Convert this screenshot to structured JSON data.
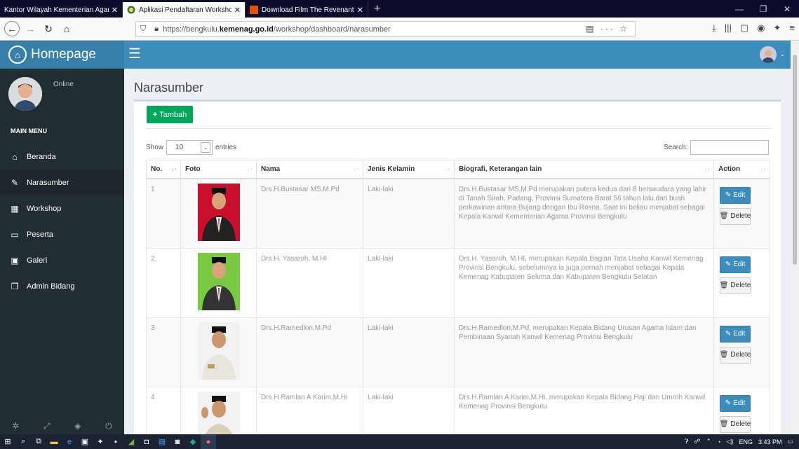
{
  "browser": {
    "tabs": [
      {
        "title": "Kantor Wilayah Kementerian Agam",
        "active": false
      },
      {
        "title": "Aplikasi Pendaftaran Workshop",
        "active": true
      },
      {
        "title": "Download Film The Revenant (",
        "active": false
      }
    ],
    "url_prefix": "https://bengkulu.",
    "url_domain": "kemenag.go.id",
    "url_path": "/workshop/dashboard/narasumber"
  },
  "sidebar": {
    "logo": "Homepage",
    "status": "Online",
    "menu_header": "MAIN MENU",
    "items": [
      {
        "label": "Beranda",
        "icon": "home-icon"
      },
      {
        "label": "Narasumber",
        "icon": "edit-icon"
      },
      {
        "label": "Workshop",
        "icon": "table-icon"
      },
      {
        "label": "Peserta",
        "icon": "monitor-icon"
      },
      {
        "label": "Galeri",
        "icon": "image-icon"
      },
      {
        "label": "Admin Bidang",
        "icon": "copy-icon"
      }
    ]
  },
  "page": {
    "title": "Narasumber",
    "add_button": "Tambah",
    "show_label": "Show",
    "entries_value": "10",
    "entries_label": "entries",
    "search_label": "Search:"
  },
  "table": {
    "headers": [
      "No.",
      "Foto",
      "Nama",
      "Jenis Kelamin",
      "Biografi, Keterangan lain",
      "Action"
    ],
    "edit_label": "Edit",
    "delete_label": "Delete",
    "rows": [
      {
        "no": "1",
        "nama": "Drs.H.Bustasar MS,M.Pd",
        "jk": "Laki-laki",
        "bio": "Drs.H.Bustasar MS,M.Pd merupakan putera kedua dari 8 bersaudara yang lahir di Tanah Sirah, Padang, Provinsi Sumatera Barat 56 tahun lalu,dari buah perkawinan antara Bujang dengan Ibu Rosna. Saat ini beliau menjabat sebagai Kepala Kanwil Kementerian Agama Provinsi Bengkulu",
        "bg": "#c8102e"
      },
      {
        "no": "2",
        "nama": "Drs.H. Yasaroh, M.HI",
        "jk": "Laki-laki",
        "bio": "Drs.H. Yasaroh, M.HI, merupakan Kepala Bagian Tata Usaha Kanwil Kemenag Provinsi Bengkulu, sebelumnya ia juga pernah menjabat sebagai Kepala Kemenag Kabupaten Seluma dan Kabupaten Bengkulu Selatan",
        "bg": "#7ac943"
      },
      {
        "no": "3",
        "nama": "Drs.H.Ramedlon,M.Pd",
        "jk": "Laki-laki",
        "bio": "Drs.H.Ramedlon,M.Pd, merupakan Kepala Bidang Urusan Agama Islam dan Pembinaan Syariah Kanwil Kemenag Provinsi Bengkulu",
        "bg": "#f2f2f2"
      },
      {
        "no": "4",
        "nama": "Drs.H.Ramlan A Karim,M.Hi",
        "jk": "Laki-laki",
        "bio": "Drs.H.Ramlan A Karim,M.Hi, merupakan Kepala Bidang Haji dan Umroh Kanwil Kemenag Provinsi Bengkulu",
        "bg": "#f2f2f2"
      }
    ]
  },
  "taskbar": {
    "lang": "ENG",
    "time": "3:43 PM"
  }
}
